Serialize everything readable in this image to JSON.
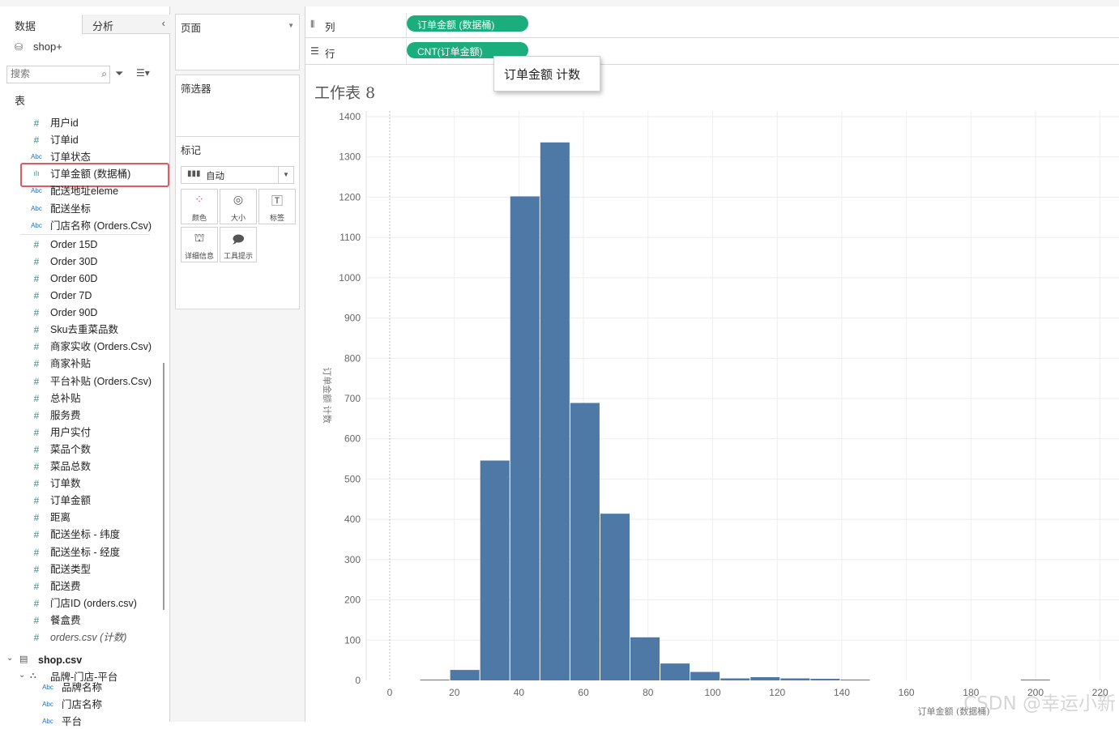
{
  "pane": {
    "tab_data": "数据",
    "tab_analysis": "分析",
    "collapse_arrow": "‹",
    "datasource_name": "shop+",
    "search_placeholder": "搜索",
    "tables_heading": "表",
    "fields": [
      {
        "type": "measure",
        "name": "用户id"
      },
      {
        "type": "measure",
        "name": "订单id"
      },
      {
        "type": "dimension",
        "name": "订单状态"
      },
      {
        "type": "bin",
        "name": "订单金额 (数据桶)"
      },
      {
        "type": "dimension",
        "name": "配送地址eleme"
      },
      {
        "type": "dimension",
        "name": "配送坐标"
      },
      {
        "type": "dimension",
        "name": "门店名称 (Orders.Csv)"
      },
      {
        "type": "measure",
        "name": "Order 15D"
      },
      {
        "type": "measure",
        "name": "Order 30D"
      },
      {
        "type": "measure",
        "name": "Order 60D"
      },
      {
        "type": "measure",
        "name": "Order 7D"
      },
      {
        "type": "measure",
        "name": "Order 90D"
      },
      {
        "type": "measure",
        "name": "Sku去重菜品数"
      },
      {
        "type": "measure",
        "name": "商家实收 (Orders.Csv)"
      },
      {
        "type": "measure",
        "name": "商家补贴"
      },
      {
        "type": "measure",
        "name": "平台补贴 (Orders.Csv)"
      },
      {
        "type": "measure",
        "name": "总补贴"
      },
      {
        "type": "measure",
        "name": "服务费"
      },
      {
        "type": "measure",
        "name": "用户实付"
      },
      {
        "type": "measure",
        "name": "菜品个数"
      },
      {
        "type": "measure",
        "name": "菜品总数"
      },
      {
        "type": "measure",
        "name": "订单数"
      },
      {
        "type": "measure",
        "name": "订单金额"
      },
      {
        "type": "measure",
        "name": "距离"
      },
      {
        "type": "measure",
        "name": "配送坐标 - 纬度"
      },
      {
        "type": "measure",
        "name": "配送坐标 - 经度"
      },
      {
        "type": "measure",
        "name": "配送类型"
      },
      {
        "type": "measure",
        "name": "配送费"
      },
      {
        "type": "measure",
        "name": "门店ID (orders.csv)"
      },
      {
        "type": "measure",
        "name": "餐盒费"
      },
      {
        "type": "count",
        "name": "orders.csv (计数)"
      }
    ],
    "shop_datasource": "shop.csv",
    "hierarchy": "品牌-门店-平台",
    "hierarchy_fields": [
      {
        "type": "dimension",
        "name": "品牌名称"
      },
      {
        "type": "dimension",
        "name": "门店名称"
      },
      {
        "type": "dimension",
        "name": "平台"
      }
    ]
  },
  "cards": {
    "pages": "页面",
    "filters": "筛选器",
    "marks": "标记",
    "marks_type": "自动",
    "buttons": {
      "color": "颜色",
      "size": "大小",
      "label": "标签",
      "detail": "详细信息",
      "tooltip": "工具提示"
    }
  },
  "shelves": {
    "columns_label": "列",
    "rows_label": "行",
    "columns_pill": "订单金额 (数据桶)",
    "rows_pill": "CNT(订单金额)"
  },
  "tooltip_text": "订单金额 计数",
  "sheet_title": "工作表 8",
  "colors": {
    "bar": "#4e79a7",
    "pill": "#1bae7c",
    "highlight": "#e05a66"
  },
  "watermark": "CSDN @幸运小新",
  "chart_data": {
    "type": "bar",
    "xlabel": "订单金额 (数据桶)",
    "ylabel": "订单金额 计数",
    "x_ticks": [
      0,
      20,
      40,
      60,
      80,
      100,
      120,
      140,
      160,
      180,
      200,
      220
    ],
    "y_ticks": [
      0,
      100,
      200,
      300,
      400,
      500,
      600,
      700,
      800,
      900,
      1000,
      1100,
      1200,
      1300,
      1400
    ],
    "xlim": [
      -7,
      225
    ],
    "ylim": [
      0,
      1400
    ],
    "bin_width": 9.3,
    "bins": [
      {
        "start": 9.3,
        "count": 2
      },
      {
        "start": 18.6,
        "count": 26
      },
      {
        "start": 27.9,
        "count": 546
      },
      {
        "start": 37.2,
        "count": 1202
      },
      {
        "start": 46.5,
        "count": 1336
      },
      {
        "start": 55.8,
        "count": 689
      },
      {
        "start": 65.1,
        "count": 414
      },
      {
        "start": 74.4,
        "count": 107
      },
      {
        "start": 83.7,
        "count": 42
      },
      {
        "start": 93.0,
        "count": 21
      },
      {
        "start": 102.3,
        "count": 5
      },
      {
        "start": 111.6,
        "count": 8
      },
      {
        "start": 120.9,
        "count": 5
      },
      {
        "start": 130.2,
        "count": 4
      },
      {
        "start": 139.5,
        "count": 1
      },
      {
        "start": 195.3,
        "count": 1
      }
    ]
  }
}
